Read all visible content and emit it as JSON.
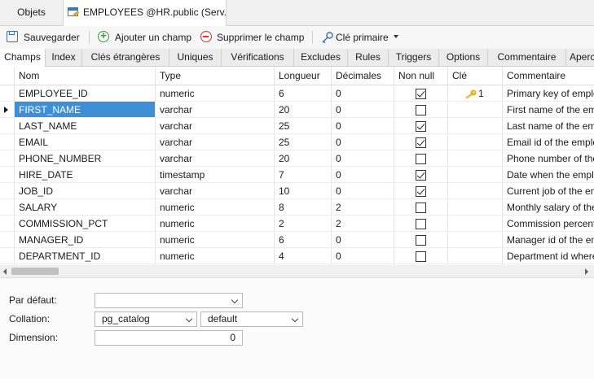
{
  "window_tabs": [
    {
      "label": "Objets"
    },
    {
      "label": "EMPLOYEES @HR.public (Serv..."
    }
  ],
  "toolbar": {
    "save": "Sauvegarder",
    "add_field": "Ajouter un champ",
    "delete_field": "Supprimer le champ",
    "primary_key": "Clé primaire"
  },
  "subtabs": [
    "Champs",
    "Index",
    "Clés étrangères",
    "Uniques",
    "Vérifications",
    "Excludes",
    "Rules",
    "Triggers",
    "Options",
    "Commentaire",
    "Aperc"
  ],
  "columns": {
    "name": "Nom",
    "type": "Type",
    "length": "Longueur",
    "decimals": "Décimales",
    "not_null": "Non null",
    "key": "Clé",
    "comment": "Commentaire"
  },
  "rows": [
    {
      "name": "EMPLOYEE_ID",
      "type": "numeric",
      "length": "6",
      "decimals": "0",
      "not_null": true,
      "key": "1",
      "comment": "Primary key of employees table."
    },
    {
      "name": "FIRST_NAME",
      "type": "varchar",
      "length": "20",
      "decimals": "0",
      "not_null": false,
      "key": "",
      "comment": "First name of the employee."
    },
    {
      "name": "LAST_NAME",
      "type": "varchar",
      "length": "25",
      "decimals": "0",
      "not_null": true,
      "key": "",
      "comment": "Last name of the employee."
    },
    {
      "name": "EMAIL",
      "type": "varchar",
      "length": "25",
      "decimals": "0",
      "not_null": true,
      "key": "",
      "comment": "Email id of the employee"
    },
    {
      "name": "PHONE_NUMBER",
      "type": "varchar",
      "length": "20",
      "decimals": "0",
      "not_null": false,
      "key": "",
      "comment": "Phone number of the employee"
    },
    {
      "name": "HIRE_DATE",
      "type": "timestamp",
      "length": "7",
      "decimals": "0",
      "not_null": true,
      "key": "",
      "comment": "Date when the employee started"
    },
    {
      "name": "JOB_ID",
      "type": "varchar",
      "length": "10",
      "decimals": "0",
      "not_null": true,
      "key": "",
      "comment": "Current job of the employee"
    },
    {
      "name": "SALARY",
      "type": "numeric",
      "length": "8",
      "decimals": "2",
      "not_null": false,
      "key": "",
      "comment": "Monthly salary of the employee"
    },
    {
      "name": "COMMISSION_PCT",
      "type": "numeric",
      "length": "2",
      "decimals": "2",
      "not_null": false,
      "key": "",
      "comment": "Commission percentage of the employee"
    },
    {
      "name": "MANAGER_ID",
      "type": "numeric",
      "length": "6",
      "decimals": "0",
      "not_null": false,
      "key": "",
      "comment": "Manager id of the employee"
    },
    {
      "name": "DEPARTMENT_ID",
      "type": "numeric",
      "length": "4",
      "decimals": "0",
      "not_null": false,
      "key": "",
      "comment": "Department id where employee works"
    }
  ],
  "selected_row": "FIRST_NAME",
  "properties": {
    "default_label": "Par défaut:",
    "default_value": "",
    "collation_label": "Collation:",
    "collation_schema": "pg_catalog",
    "collation_name": "default",
    "dimension_label": "Dimension:",
    "dimension_value": "0"
  },
  "colors": {
    "selection": "#3d8fd8",
    "key_icon": "#e8b02a",
    "add_icon": "#3a9a3a",
    "delete_icon": "#d9342b"
  },
  "icons": [
    "table-icon",
    "save-icon",
    "add-icon",
    "delete-icon",
    "key-icon",
    "primary-key-icon",
    "row-pointer-icon"
  ]
}
